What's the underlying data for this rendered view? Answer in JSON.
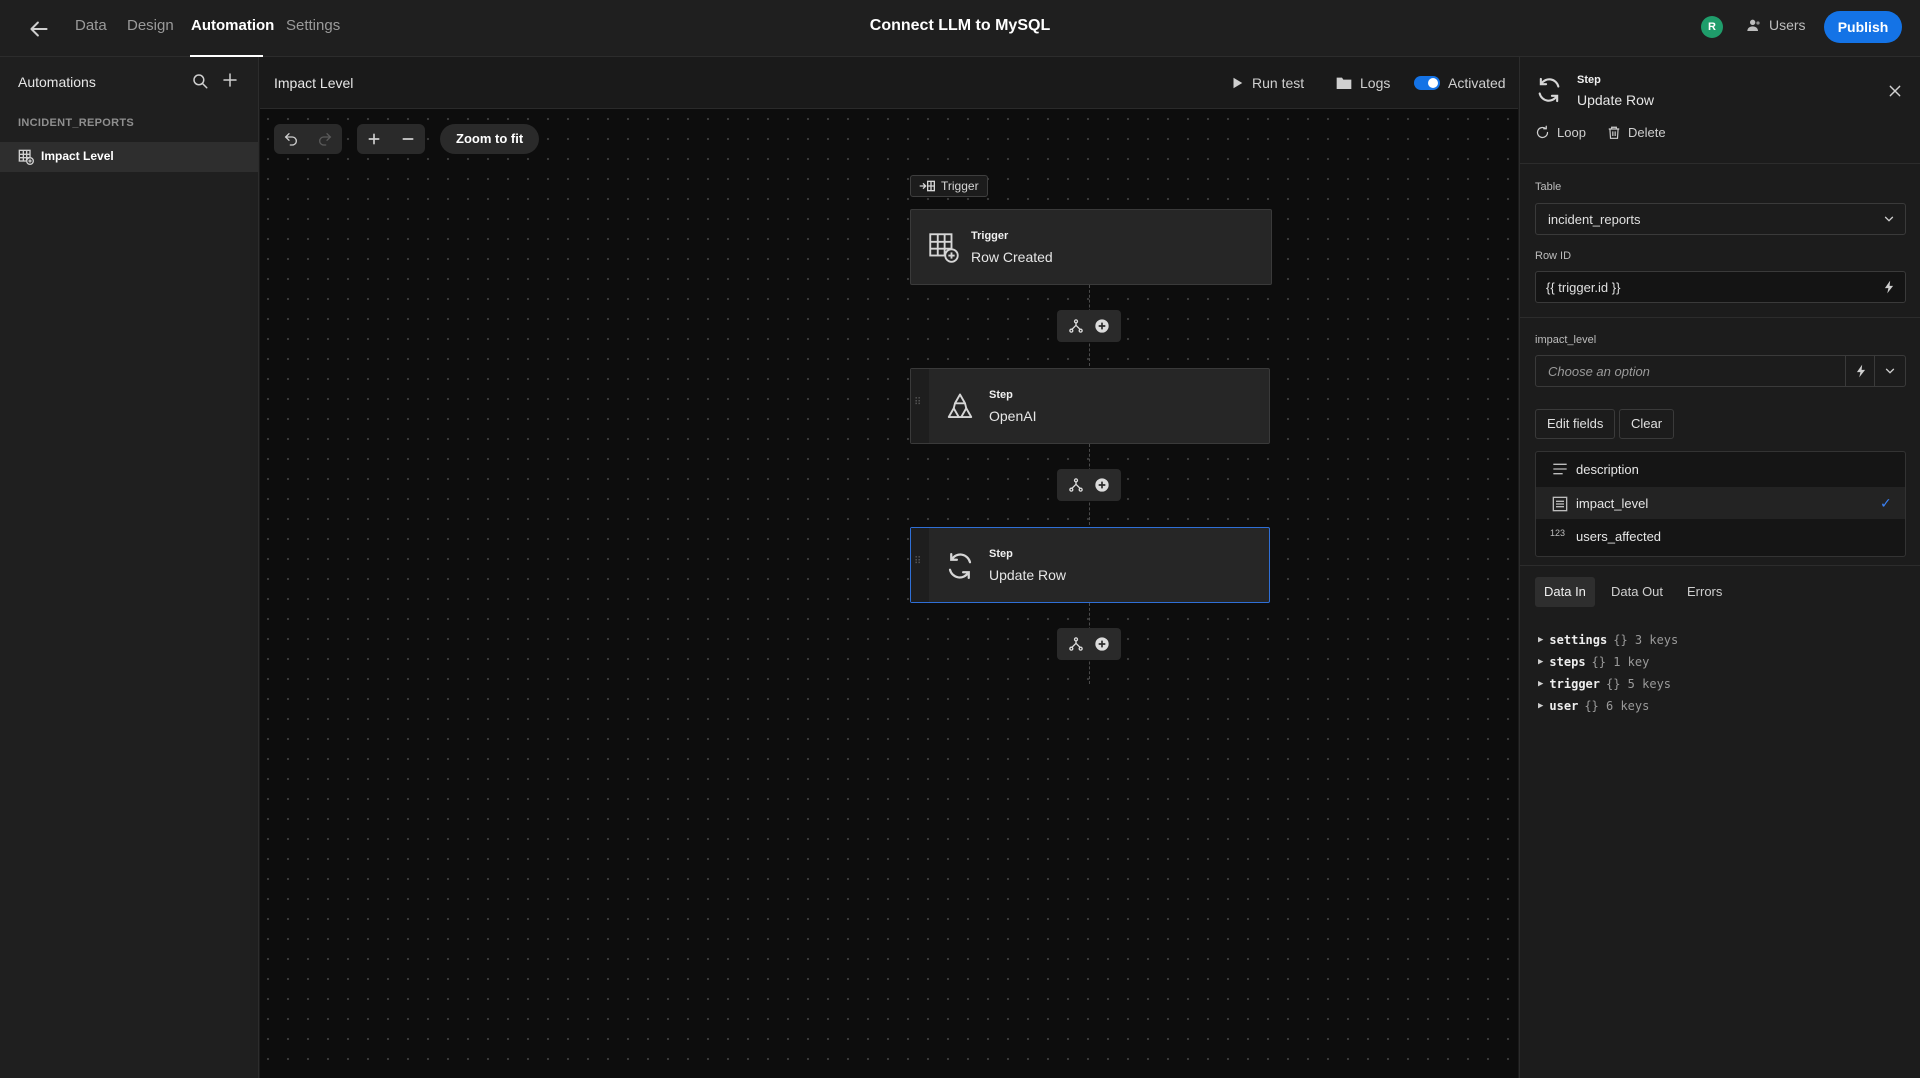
{
  "topbar": {
    "tabs": [
      {
        "label": "Data",
        "active": false
      },
      {
        "label": "Design",
        "active": false
      },
      {
        "label": "Automation",
        "active": true
      },
      {
        "label": "Settings",
        "active": false
      }
    ],
    "app_title": "Connect LLM to MySQL",
    "avatar_initial": "R",
    "avatar_color": "#1f9d6b",
    "users_label": "Users",
    "publish_label": "Publish",
    "accent_color": "#1473e6"
  },
  "sidebar": {
    "title": "Automations",
    "group_label": "INCIDENT_REPORTS",
    "items": [
      {
        "label": "Impact Level",
        "selected": true
      }
    ]
  },
  "canvas": {
    "title": "Impact Level",
    "run_test_label": "Run test",
    "logs_label": "Logs",
    "activated_label": "Activated",
    "activated": true,
    "zoom_to_fit_label": "Zoom to fit",
    "trigger_tag_label": "Trigger",
    "nodes": [
      {
        "kind": "Trigger",
        "name": "Row Created",
        "icon": "table-add-icon"
      },
      {
        "kind": "Step",
        "name": "OpenAI",
        "icon": "openai-icon"
      },
      {
        "kind": "Step",
        "name": "Update Row",
        "icon": "refresh-icon",
        "selected": true
      }
    ]
  },
  "panel": {
    "kind": "Step",
    "name": "Update Row",
    "loop_label": "Loop",
    "delete_label": "Delete",
    "table_label": "Table",
    "table_value": "incident_reports",
    "row_id_label": "Row ID",
    "row_id_value": "{{ trigger.id }}",
    "impact_label": "impact_level",
    "impact_placeholder": "Choose an option",
    "edit_fields_label": "Edit fields",
    "clear_label": "Clear",
    "fields": [
      {
        "icon": "text-icon",
        "label": "description",
        "checked": false
      },
      {
        "icon": "options-icon",
        "label": "impact_level",
        "checked": true
      },
      {
        "icon": "number-icon",
        "icon_text": "123",
        "label": "users_affected",
        "checked": false
      }
    ],
    "data_tabs": [
      {
        "label": "Data In",
        "active": true
      },
      {
        "label": "Data Out",
        "active": false
      },
      {
        "label": "Errors",
        "active": false
      }
    ],
    "tree": [
      {
        "key": "settings",
        "info": "{} 3 keys"
      },
      {
        "key": "steps",
        "info": "{} 1 key"
      },
      {
        "key": "trigger",
        "info": "{} 5 keys"
      },
      {
        "key": "user",
        "info": "{} 6 keys"
      }
    ]
  }
}
